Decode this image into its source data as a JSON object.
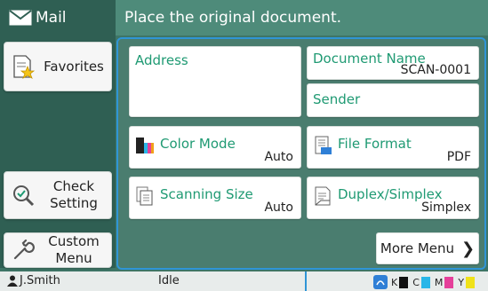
{
  "header": {
    "app_title": "Mail",
    "message": "Place the original document."
  },
  "sidebar": {
    "favorites_label": "Favorites",
    "check_label_1": "Check",
    "check_label_2": "Setting",
    "custom_label_1": "Custom",
    "custom_label_2": "Menu"
  },
  "main": {
    "address_label": "Address",
    "document_name": {
      "label": "Document Name",
      "value": "SCAN-0001"
    },
    "sender_label": "Sender",
    "color_mode": {
      "label": "Color Mode",
      "value": "Auto"
    },
    "file_format": {
      "label": "File Format",
      "value": "PDF"
    },
    "scanning_size": {
      "label": "Scanning Size",
      "value": "Auto"
    },
    "duplex_simplex": {
      "label": "Duplex/Simplex",
      "value": "Simplex"
    },
    "more_menu_label": "More Menu"
  },
  "status": {
    "user": "J.Smith",
    "state": "Idle",
    "ink": {
      "k": "K",
      "c": "C",
      "m": "M",
      "y": "Y",
      "colors": {
        "k": "#111111",
        "c": "#29b6e8",
        "m": "#e5409a",
        "y": "#f0e21a"
      }
    }
  },
  "colors": {
    "accent_green": "#1f9a73",
    "selection_blue": "#2f95d6",
    "panel_dark": "#2f5f53"
  }
}
